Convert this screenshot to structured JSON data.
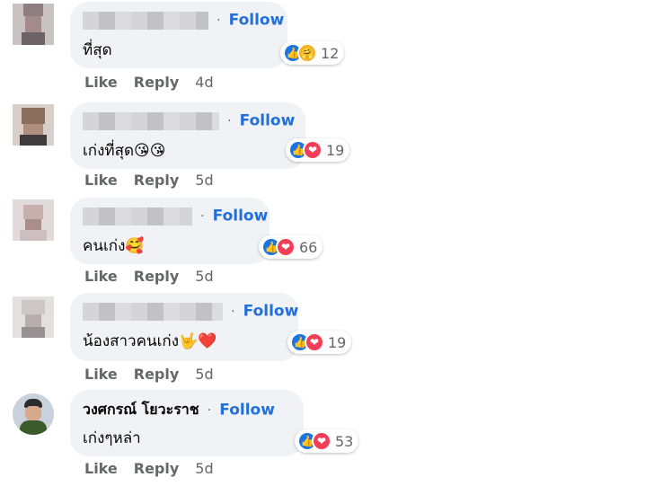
{
  "comments": [
    {
      "name": "",
      "follow": "Follow",
      "text": "ที่สุด",
      "reactions": [
        "like",
        "care"
      ],
      "reaction_count": "12",
      "like": "Like",
      "reply": "Reply",
      "time": "4d"
    },
    {
      "name": "",
      "follow": "Follow",
      "text": "เก่งที่สุด😘😘",
      "reactions": [
        "like",
        "love"
      ],
      "reaction_count": "19",
      "like": "Like",
      "reply": "Reply",
      "time": "5d"
    },
    {
      "name": "",
      "follow": "Follow",
      "text": "คนเก่ง🥰",
      "reactions": [
        "like",
        "love"
      ],
      "reaction_count": "66",
      "like": "Like",
      "reply": "Reply",
      "time": "5d"
    },
    {
      "name": "",
      "follow": "Follow",
      "text": "น้องสาวคนเก่ง🤟❤️",
      "reactions": [
        "like",
        "love"
      ],
      "reaction_count": "19",
      "like": "Like",
      "reply": "Reply",
      "time": "5d"
    },
    {
      "name": "วงศกรณ์ โยวะราช",
      "follow": "Follow",
      "text": "เก่งๆหล่า",
      "reactions": [
        "like",
        "love"
      ],
      "reaction_count": "53",
      "like": "Like",
      "reply": "Reply",
      "time": "5d"
    }
  ],
  "separator": "·"
}
